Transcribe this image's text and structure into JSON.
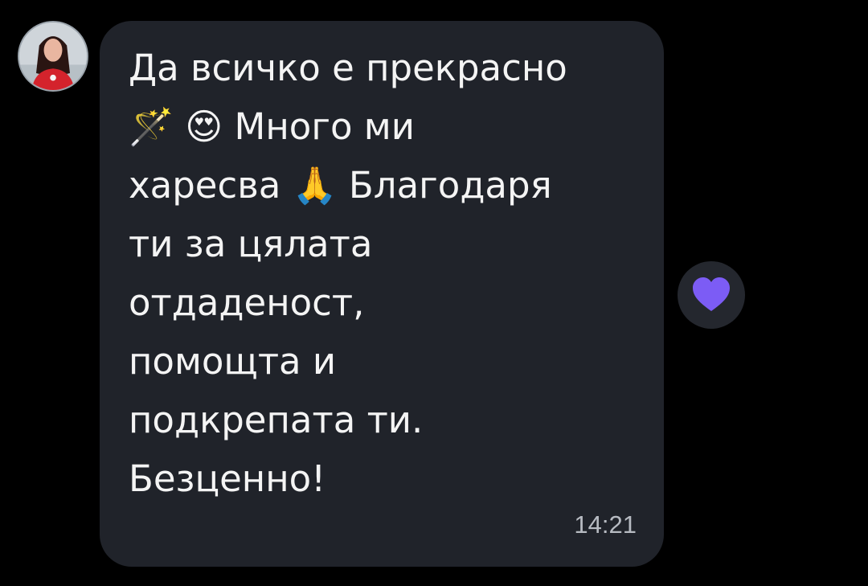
{
  "message": {
    "text": "Да всичко е прекрасно\n🪄 😍 Много ми\nхаресва 🙏 Благодаря\nти за цялата\nотдаденост,\nпомощта и\nподкрепата ти.\nБезценно!",
    "time": "14:21"
  },
  "sender": {
    "avatar_icon": "profile-photo"
  },
  "reaction": {
    "icon": "heart-icon",
    "color": "#7c5cf5"
  },
  "colors": {
    "background": "#000000",
    "bubble": "#20232a",
    "text": "#f4f4f4",
    "timestamp": "#b7bbc2"
  }
}
